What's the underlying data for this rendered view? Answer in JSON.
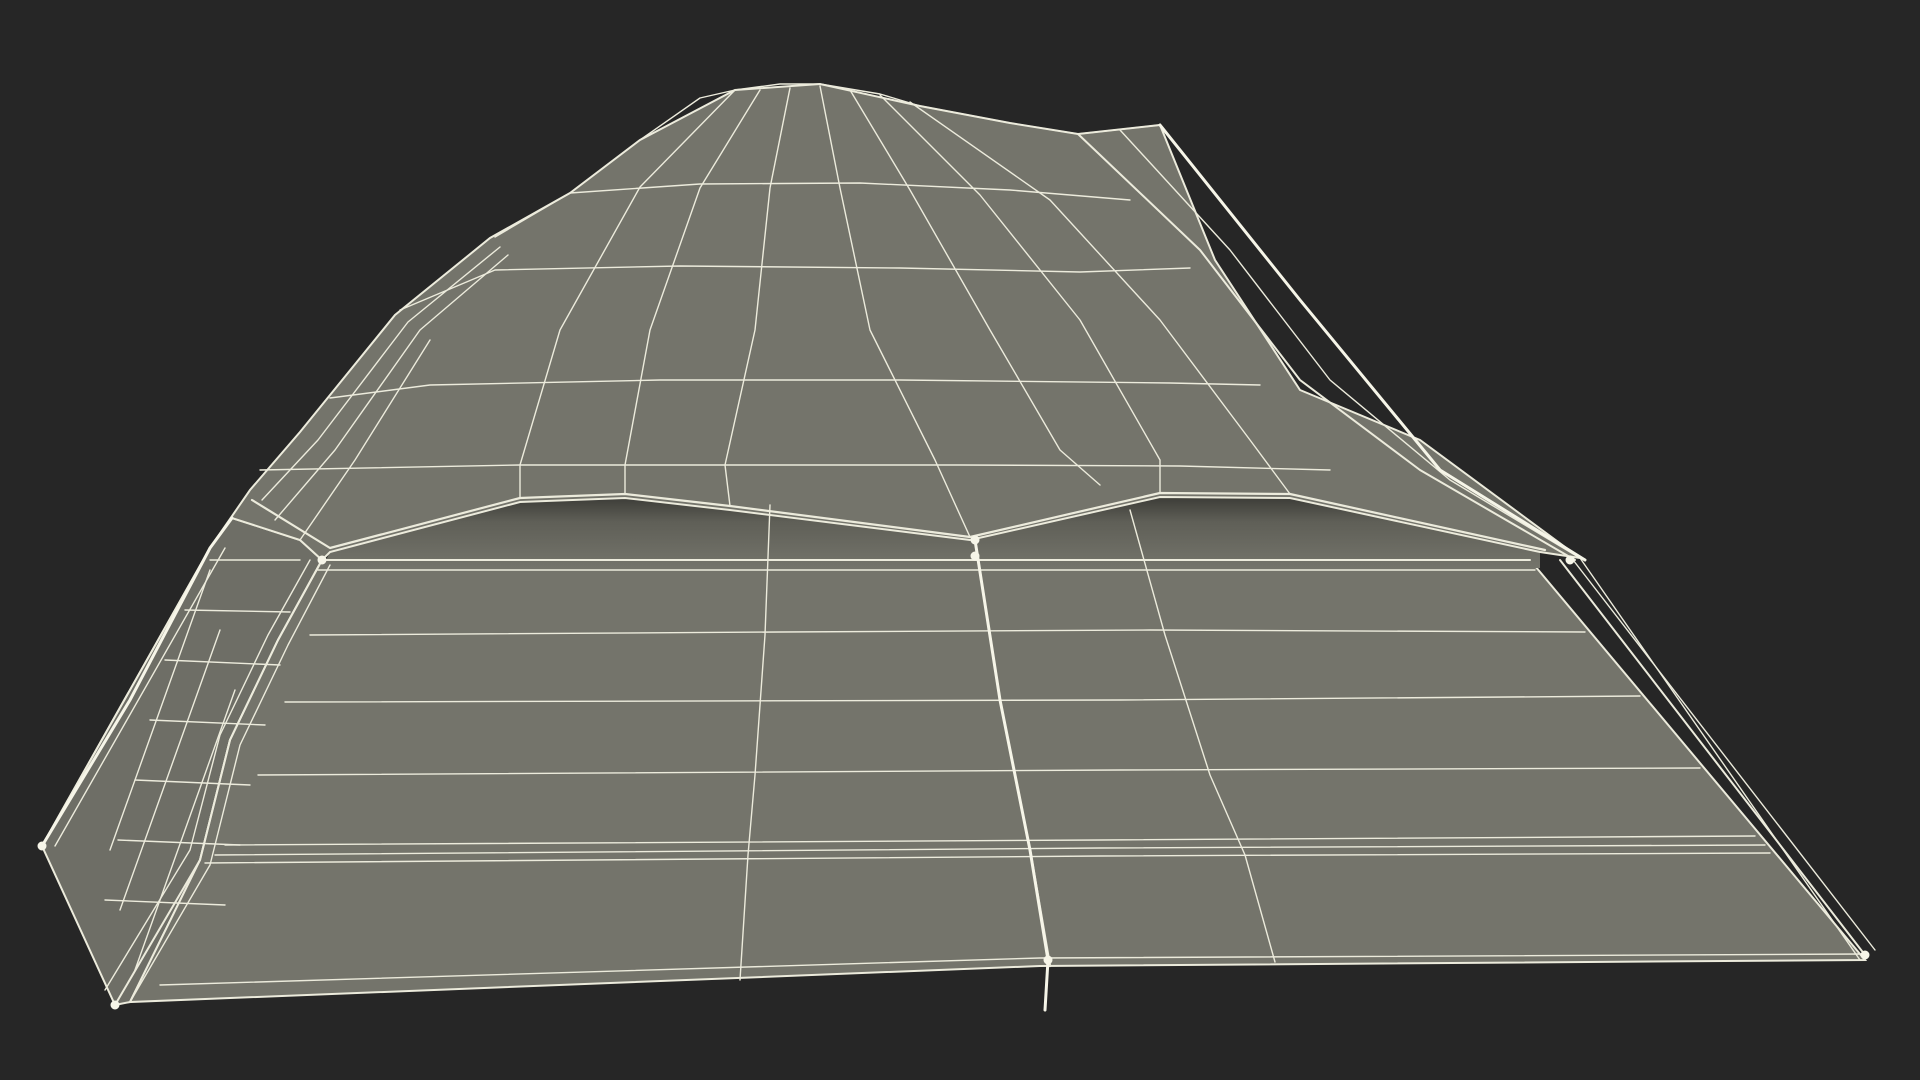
{
  "scene": {
    "subject": "tent-wireframe-render",
    "background_color": "#262626",
    "surface_color": "#74746b",
    "surface_dark_color": "#55554d",
    "wire_color": "#ecebdc",
    "pole_color": "#f6f5e8"
  }
}
